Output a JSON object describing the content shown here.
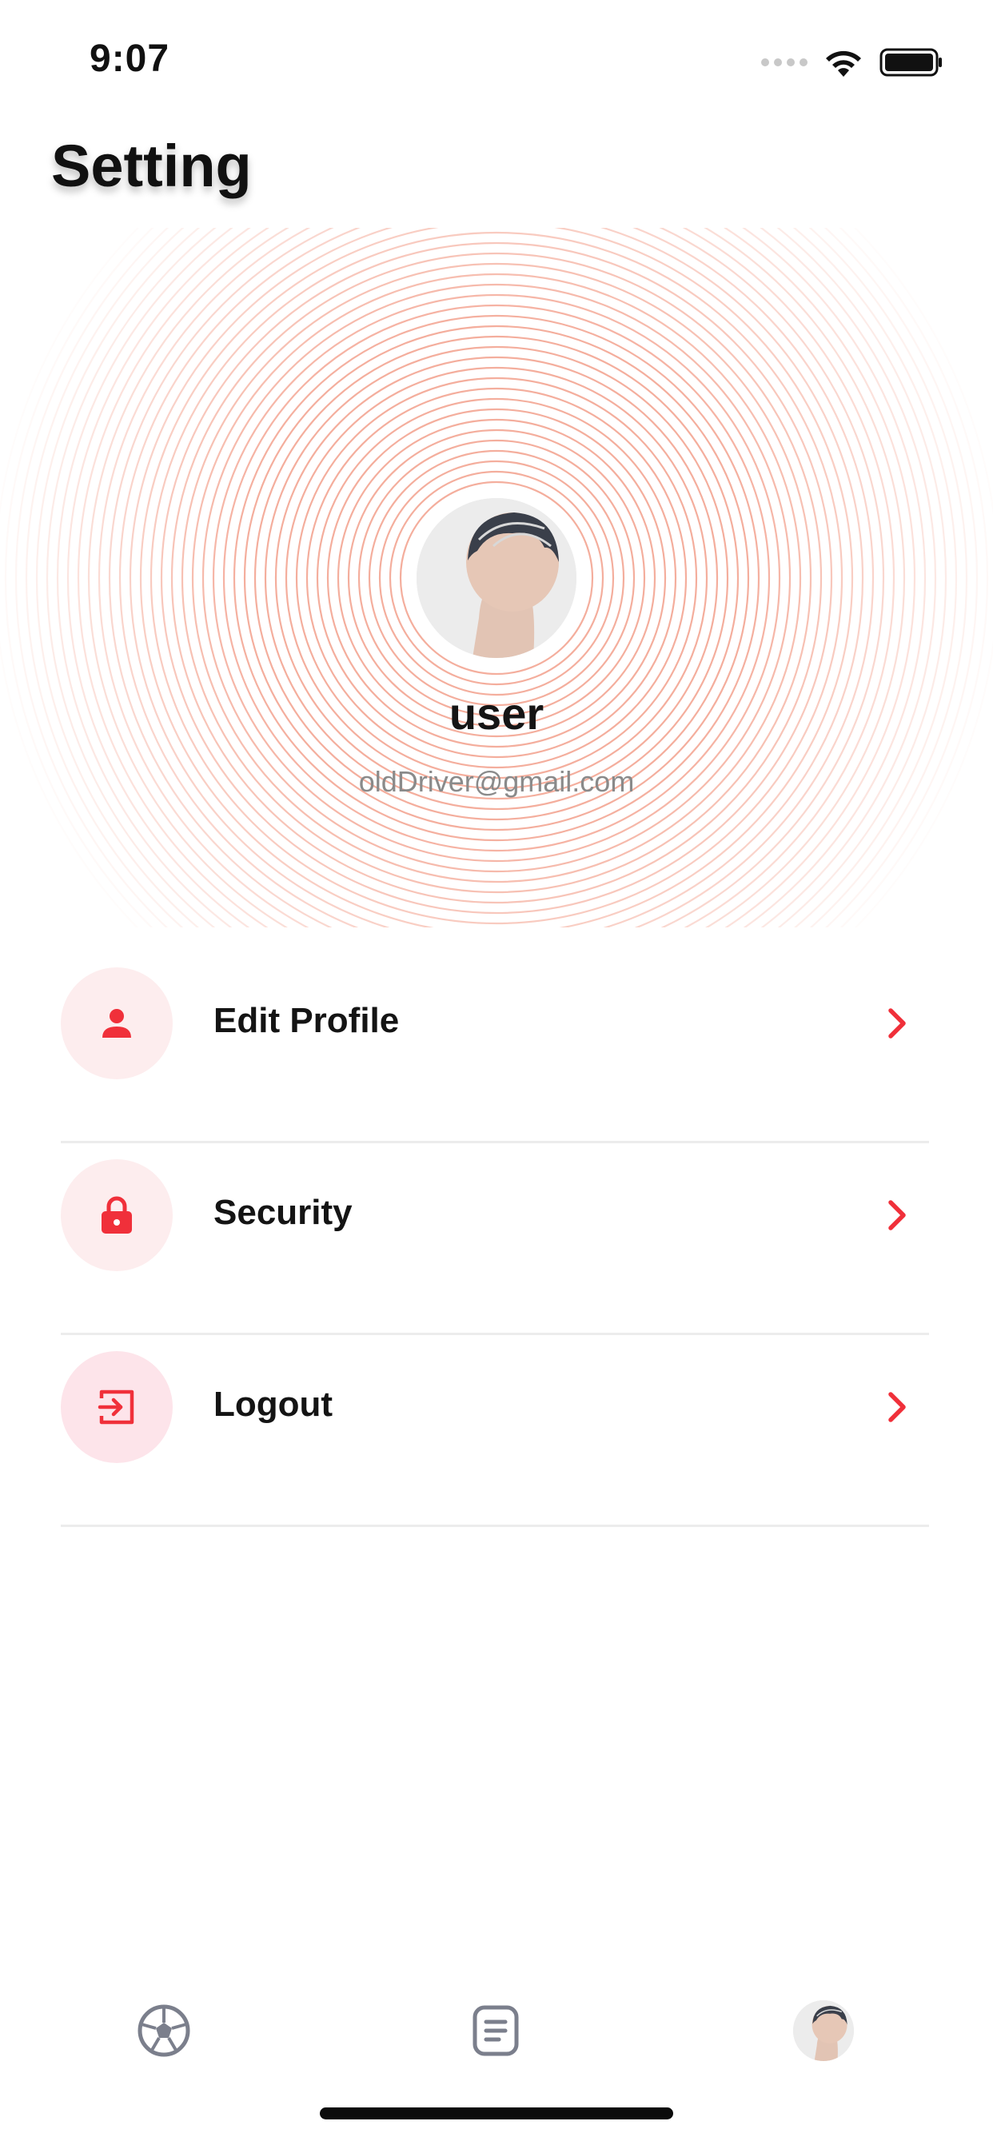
{
  "status_bar": {
    "time": "9:07"
  },
  "header": {
    "title": "Setting"
  },
  "profile": {
    "name": "user",
    "email": "oldDriver@gmail.com"
  },
  "menu": {
    "items": [
      {
        "label": "Edit Profile",
        "icon": "person-icon"
      },
      {
        "label": "Security",
        "icon": "lock-icon"
      },
      {
        "label": "Logout",
        "icon": "logout-icon"
      }
    ]
  },
  "tab_bar": {
    "tabs": [
      {
        "icon": "soccer-ball-icon"
      },
      {
        "icon": "document-icon"
      },
      {
        "icon": "avatar-icon",
        "selected": true
      }
    ]
  },
  "colors": {
    "accent": "#F0303A",
    "icon_bg": "#FDECEE",
    "ring": "#F3A08C",
    "tab_icon": "#7B7F8C"
  }
}
